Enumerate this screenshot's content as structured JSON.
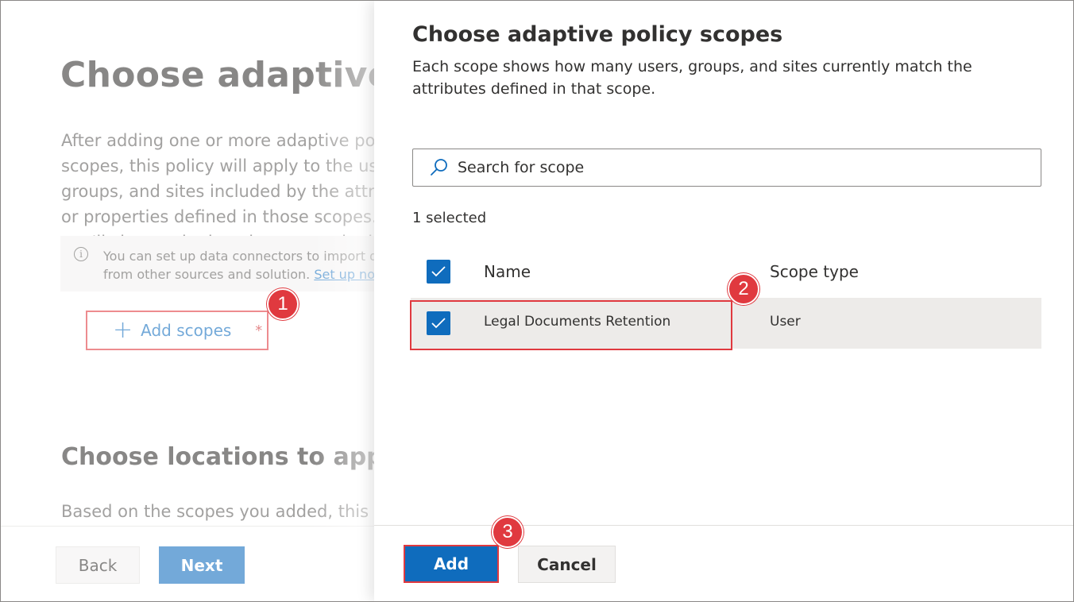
{
  "background_page": {
    "title": "Choose adaptive policy scopes",
    "description": "After adding one or more adaptive policy scopes, this policy will apply to the users, groups, and sites included by the attributes or properties defined in those scopes. Next, you'll choose the locations to apply the policy to.",
    "info_text": "You can set up data connectors to import data from other sources and solution.",
    "info_link": "Set up now",
    "add_scopes_label": "Add scopes",
    "required_marker": "*",
    "locations_heading": "Choose locations to apply the policy",
    "locations_description": "Based on the scopes you added, this policy",
    "back_label": "Back",
    "next_label": "Next"
  },
  "panel": {
    "title": "Choose adaptive policy scopes",
    "description": "Each scope shows how many users, groups, and sites currently match the attributes defined in that scope.",
    "search_placeholder": "Search for scope",
    "selected_count": "1 selected",
    "columns": {
      "name": "Name",
      "scope_type": "Scope type"
    },
    "rows": [
      {
        "name": "Legal Documents Retention",
        "scope_type": "User",
        "checked": true
      }
    ],
    "add_label": "Add",
    "cancel_label": "Cancel"
  },
  "steps": [
    "1",
    "2",
    "3"
  ],
  "colors": {
    "accent": "#0f6cbd",
    "highlight": "#e0393f",
    "row_selected": "#edebe9"
  },
  "icons": {
    "search": "search-icon",
    "info": "info-icon",
    "add": "plus-icon",
    "check": "checkmark-icon"
  }
}
